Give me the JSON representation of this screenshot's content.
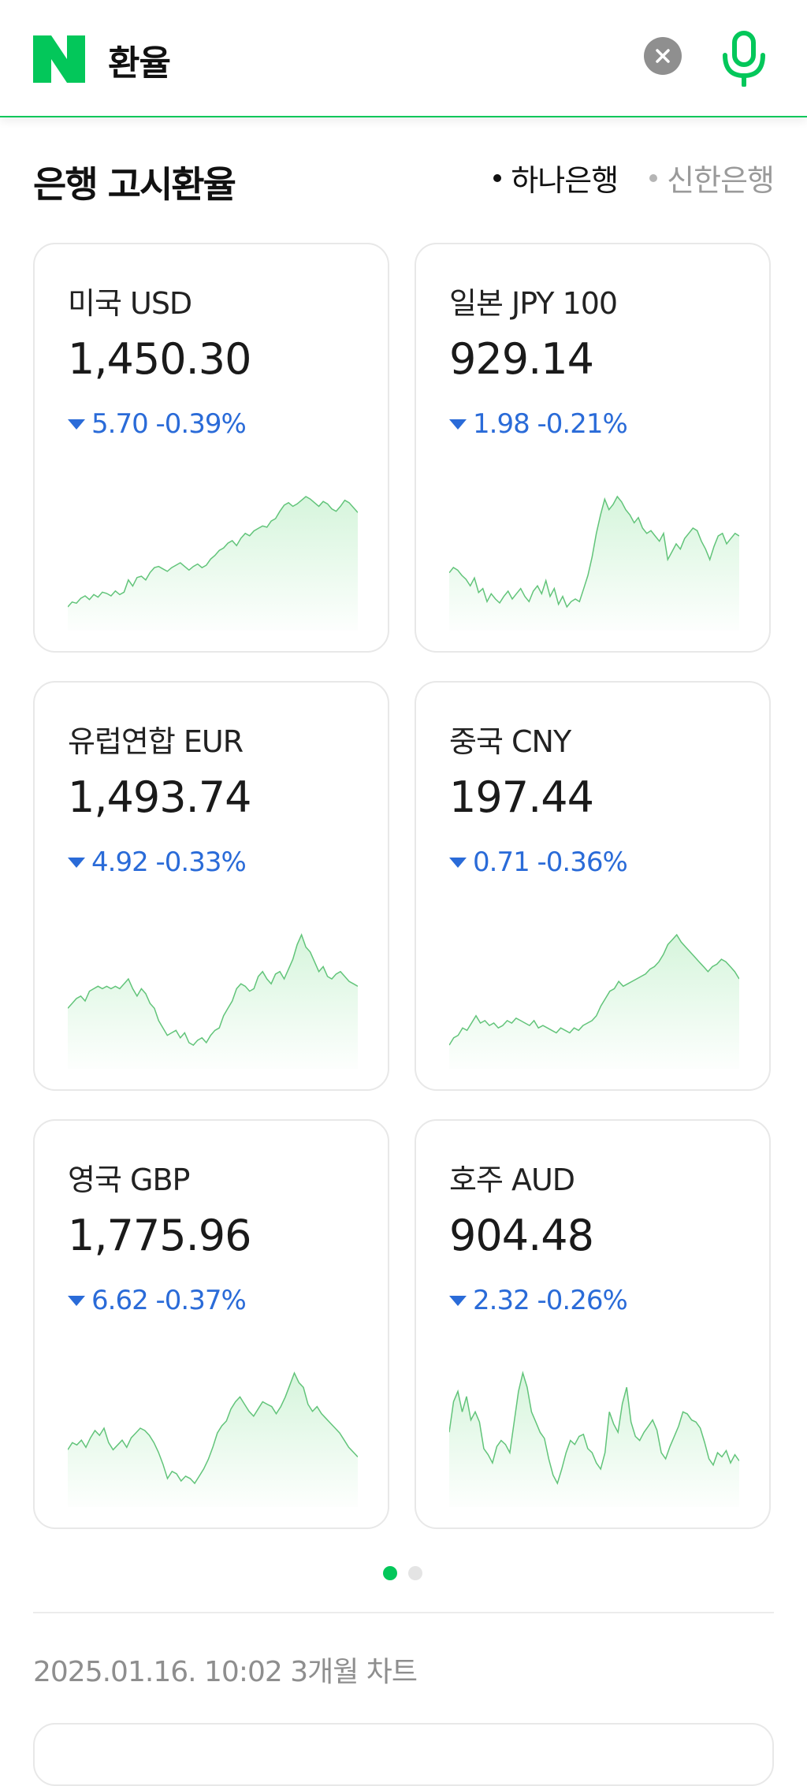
{
  "search": {
    "query": "환율"
  },
  "colors": {
    "brand": "#03c75a",
    "down": "#2a6bd8",
    "sparkFill": "#d6f5dc",
    "sparkLine": "#62c47a"
  },
  "icons": {
    "logo": "naver-n-icon",
    "clear": "close-icon",
    "mic": "microphone-icon",
    "down": "triangle-down-icon"
  },
  "section": {
    "title": "은행 고시환율",
    "banks": [
      {
        "label": "하나은행",
        "selected": true
      },
      {
        "label": "신한은행",
        "selected": false
      }
    ]
  },
  "rates": [
    {
      "name": "미국 USD",
      "rate": "1,450.30",
      "change": "5.70 -0.39%",
      "direction": "down",
      "trend": [
        8,
        12,
        11,
        15,
        17,
        14,
        18,
        16,
        20,
        19,
        17,
        21,
        18,
        20,
        30,
        25,
        32,
        33,
        30,
        36,
        40,
        41,
        39,
        37,
        40,
        42,
        44,
        41,
        38,
        41,
        43,
        40,
        42,
        47,
        50,
        54,
        56,
        60,
        62,
        58,
        64,
        68,
        66,
        70,
        72,
        74,
        73,
        78,
        80,
        86,
        91,
        93,
        90,
        92,
        95,
        98,
        96,
        93,
        90,
        94,
        92,
        88,
        86,
        90,
        95,
        93,
        89,
        85
      ]
    },
    {
      "name": "일본 JPY 100",
      "rate": "929.14",
      "change": "1.98 -0.21%",
      "direction": "down",
      "trend": [
        40,
        44,
        42,
        38,
        35,
        30,
        36,
        25,
        28,
        18,
        24,
        20,
        17,
        22,
        26,
        20,
        24,
        28,
        22,
        18,
        26,
        30,
        24,
        34,
        22,
        28,
        16,
        22,
        14,
        18,
        20,
        18,
        28,
        38,
        52,
        70,
        84,
        96,
        88,
        92,
        98,
        94,
        88,
        84,
        78,
        82,
        74,
        70,
        72,
        68,
        64,
        70,
        50,
        56,
        62,
        58,
        66,
        70,
        74,
        72,
        64,
        58,
        50,
        60,
        68,
        70,
        62,
        66,
        70,
        68
      ]
    },
    {
      "name": "유럽연합 EUR",
      "rate": "1,493.74",
      "change": "4.92 -0.33%",
      "direction": "down",
      "trend": [
        40,
        44,
        48,
        50,
        46,
        54,
        56,
        58,
        56,
        58,
        56,
        58,
        56,
        60,
        64,
        56,
        50,
        56,
        52,
        44,
        40,
        30,
        24,
        18,
        20,
        22,
        16,
        20,
        12,
        10,
        14,
        16,
        12,
        18,
        22,
        24,
        34,
        40,
        46,
        56,
        60,
        58,
        54,
        56,
        66,
        70,
        64,
        60,
        68,
        70,
        64,
        72,
        80,
        92,
        100,
        90,
        86,
        78,
        70,
        74,
        66,
        64,
        68,
        70,
        66,
        62,
        60,
        58
      ]
    },
    {
      "name": "중국 CNY",
      "rate": "197.44",
      "change": "0.71 -0.36%",
      "direction": "down",
      "trend": [
        10,
        16,
        18,
        24,
        22,
        28,
        34,
        28,
        30,
        26,
        28,
        24,
        26,
        30,
        28,
        32,
        30,
        28,
        26,
        30,
        24,
        26,
        24,
        22,
        20,
        24,
        22,
        20,
        24,
        22,
        26,
        28,
        30,
        34,
        42,
        48,
        54,
        56,
        62,
        58,
        60,
        62,
        64,
        66,
        68,
        72,
        74,
        78,
        84,
        92,
        96,
        100,
        94,
        90,
        86,
        82,
        78,
        74,
        70,
        74,
        76,
        80,
        78,
        74,
        70,
        64
      ]
    },
    {
      "name": "영국 GBP",
      "rate": "1,775.96",
      "change": "6.62 -0.37%",
      "direction": "down",
      "trend": [
        40,
        46,
        44,
        48,
        42,
        50,
        56,
        52,
        58,
        46,
        40,
        44,
        48,
        42,
        50,
        54,
        58,
        56,
        52,
        46,
        38,
        28,
        16,
        22,
        20,
        14,
        18,
        16,
        12,
        18,
        24,
        32,
        42,
        54,
        60,
        64,
        74,
        80,
        84,
        78,
        72,
        68,
        74,
        80,
        78,
        76,
        70,
        76,
        84,
        94,
        104,
        96,
        92,
        78,
        72,
        76,
        70,
        66,
        62,
        58,
        54,
        48,
        42,
        38,
        34
      ]
    },
    {
      "name": "호주 AUD",
      "rate": "904.48",
      "change": "2.32 -0.26%",
      "direction": "down",
      "trend": [
        60,
        90,
        100,
        80,
        95,
        72,
        80,
        70,
        44,
        38,
        30,
        46,
        52,
        48,
        40,
        70,
        100,
        118,
        104,
        80,
        70,
        60,
        54,
        34,
        18,
        10,
        24,
        40,
        52,
        48,
        56,
        58,
        44,
        40,
        30,
        24,
        40,
        80,
        68,
        60,
        88,
        104,
        70,
        56,
        52,
        60,
        66,
        72,
        62,
        40,
        34,
        46,
        56,
        66,
        80,
        78,
        72,
        70,
        64,
        50,
        34,
        28,
        40,
        36,
        42,
        30,
        38,
        32
      ]
    }
  ],
  "pager": {
    "pages": 2,
    "current": 1
  },
  "footer": {
    "timestamp": "2025.01.16. 10:02 3개월 차트"
  }
}
